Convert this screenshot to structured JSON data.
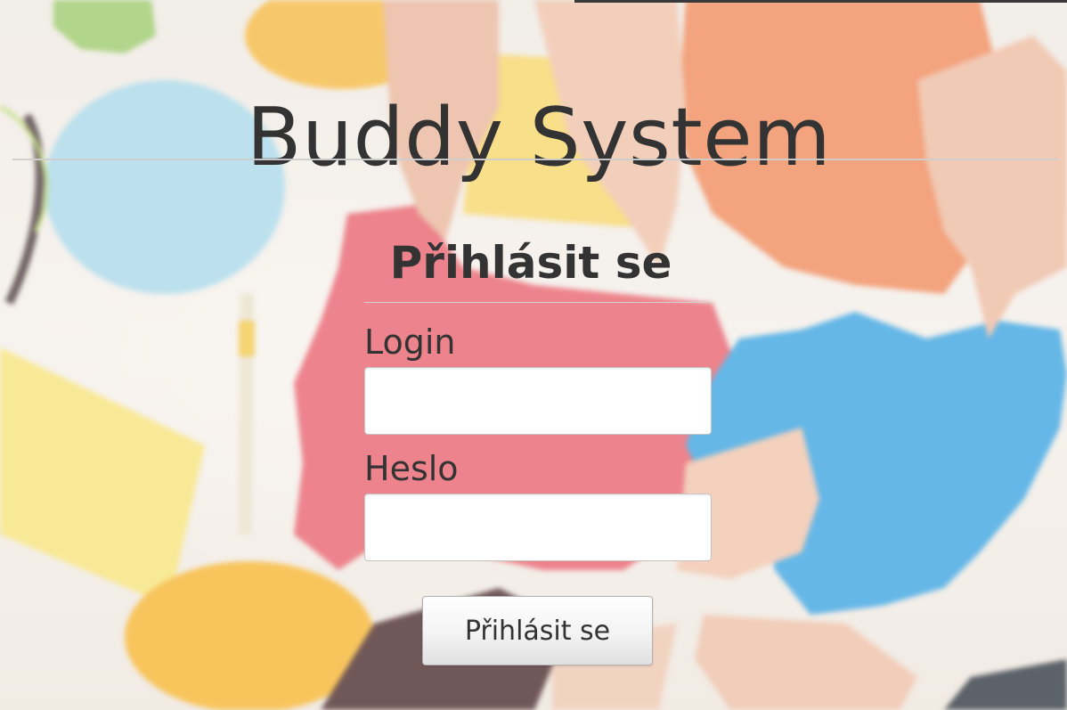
{
  "app": {
    "title": "Buddy System"
  },
  "login_form": {
    "heading": "Přihlásit se",
    "login_label": "Login",
    "login_value": "",
    "password_label": "Heslo",
    "password_value": "",
    "submit_label": "Přihlásit se"
  },
  "background": {
    "description_icon": "world-map-collage",
    "colors": {
      "red_region": "#e8616c",
      "blue_region": "#3aa3e0",
      "orange_region": "#f08a5a",
      "yellow_note": "#f7d66a",
      "bubble_blue": "#a9d8e8"
    }
  }
}
